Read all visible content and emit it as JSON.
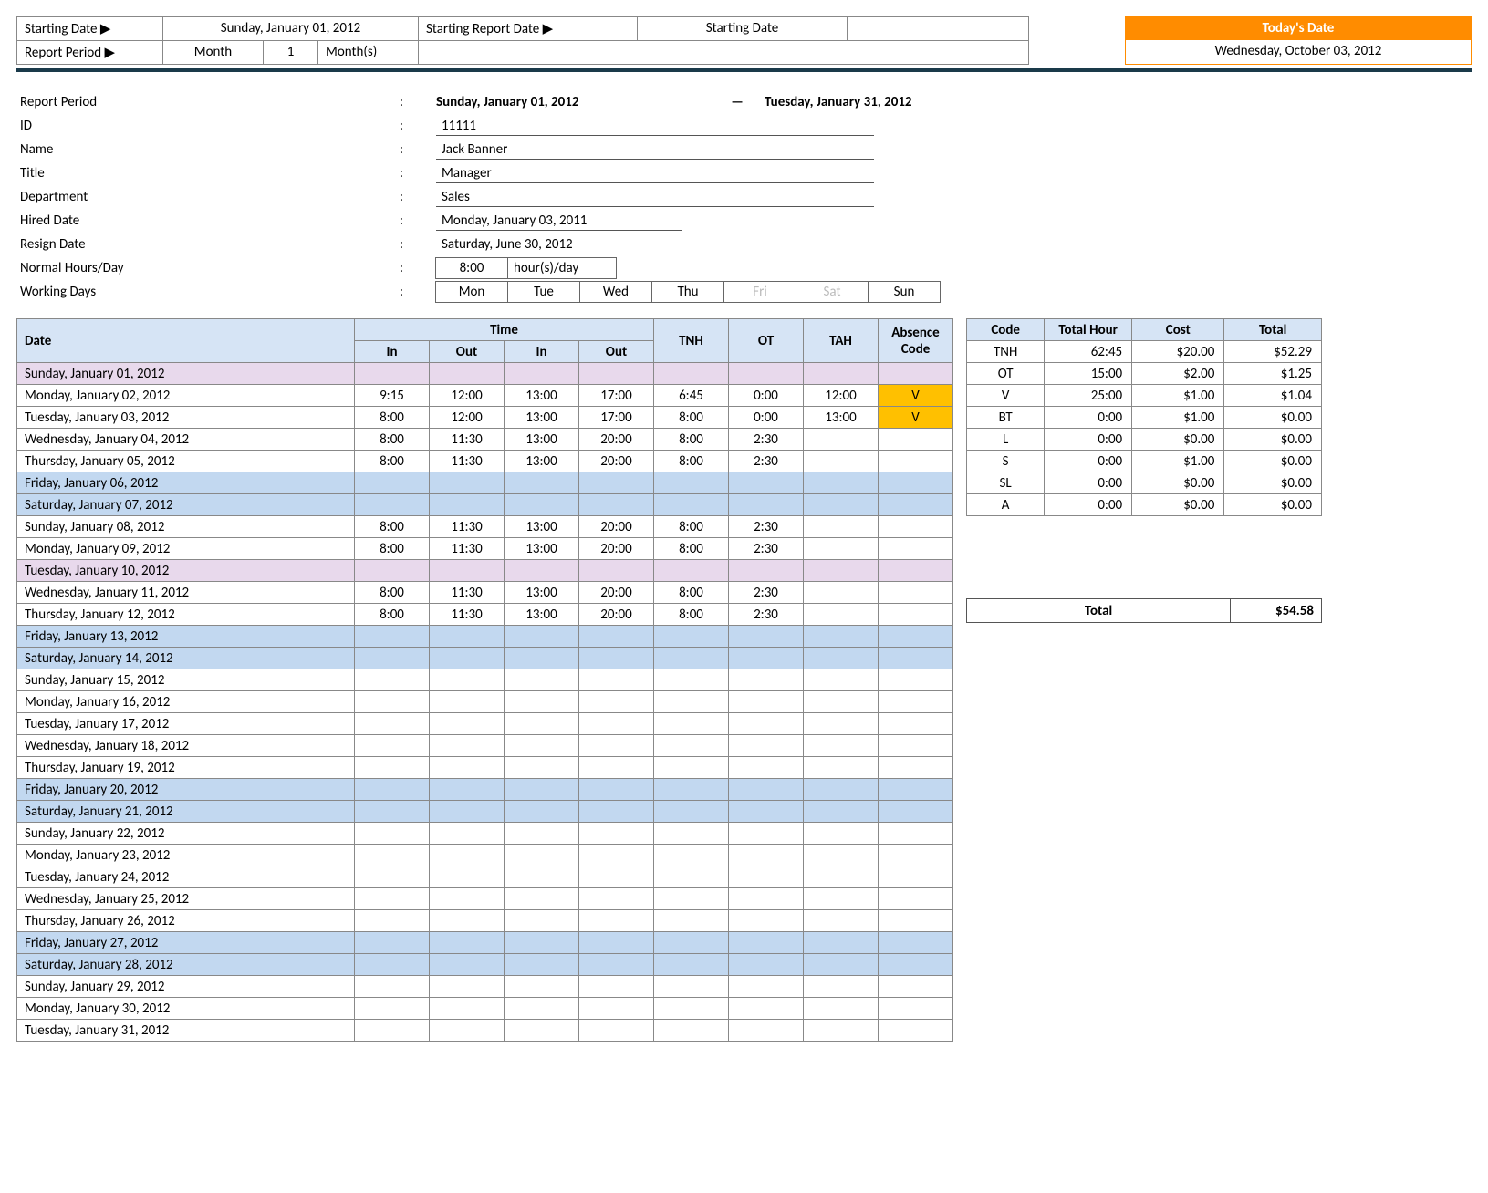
{
  "top": {
    "starting_date_lbl": "Starting Date ▶",
    "starting_date_val": "Sunday, January 01, 2012",
    "starting_report_lbl": "Starting Report Date ▶",
    "starting_report_val": "Starting Date",
    "report_period_lbl": "Report Period ▶",
    "report_period_type": "Month",
    "report_period_n": "1",
    "report_period_unit": "Month(s)",
    "today_hdr": "Today's Date",
    "today_val": "Wednesday, October 03, 2012"
  },
  "info": {
    "report_period_lbl": "Report Period",
    "report_period_from": "Sunday, January 01, 2012",
    "report_period_to": "Tuesday, January 31, 2012",
    "id_lbl": "ID",
    "id_val": "11111",
    "name_lbl": "Name",
    "name_val": "Jack Banner",
    "title_lbl": "Title",
    "title_val": "Manager",
    "dept_lbl": "Department",
    "dept_val": "Sales",
    "hired_lbl": "Hired Date",
    "hired_val": "Monday, January 03, 2011",
    "resign_lbl": "Resign Date",
    "resign_val": "Saturday, June 30, 2012",
    "normal_lbl": "Normal Hours/Day",
    "normal_hrs": "8:00",
    "normal_unit": "hour(s)/day",
    "working_lbl": "Working Days",
    "days": [
      "Mon",
      "Tue",
      "Wed",
      "Thu",
      "Fri",
      "Sat",
      "Sun"
    ],
    "days_off": [
      false,
      false,
      false,
      false,
      true,
      true,
      false
    ]
  },
  "ts_headers": {
    "date": "Date",
    "time": "Time",
    "in": "In",
    "out": "Out",
    "tnh": "TNH",
    "ot": "OT",
    "tah": "TAH",
    "abs": "Absence Code"
  },
  "ts_rows": [
    {
      "date": "Sunday, January 01, 2012",
      "cls": "purple"
    },
    {
      "date": "Monday, January 02, 2012",
      "in1": "9:15",
      "out1": "12:00",
      "in2": "13:00",
      "out2": "17:00",
      "tnh": "6:45",
      "ot": "0:00",
      "tah": "12:00",
      "abs": "V"
    },
    {
      "date": "Tuesday, January 03, 2012",
      "in1": "8:00",
      "out1": "12:00",
      "in2": "13:00",
      "out2": "17:00",
      "tnh": "8:00",
      "ot": "0:00",
      "tah": "13:00",
      "abs": "V"
    },
    {
      "date": "Wednesday, January 04, 2012",
      "in1": "8:00",
      "out1": "11:30",
      "in2": "13:00",
      "out2": "20:00",
      "tnh": "8:00",
      "ot": "2:30"
    },
    {
      "date": "Thursday, January 05, 2012",
      "in1": "8:00",
      "out1": "11:30",
      "in2": "13:00",
      "out2": "20:00",
      "tnh": "8:00",
      "ot": "2:30"
    },
    {
      "date": "Friday, January 06, 2012",
      "cls": "blue"
    },
    {
      "date": "Saturday, January 07, 2012",
      "cls": "blue"
    },
    {
      "date": "Sunday, January 08, 2012",
      "in1": "8:00",
      "out1": "11:30",
      "in2": "13:00",
      "out2": "20:00",
      "tnh": "8:00",
      "ot": "2:30"
    },
    {
      "date": "Monday, January 09, 2012",
      "in1": "8:00",
      "out1": "11:30",
      "in2": "13:00",
      "out2": "20:00",
      "tnh": "8:00",
      "ot": "2:30"
    },
    {
      "date": "Tuesday, January 10, 2012",
      "cls": "purple"
    },
    {
      "date": "Wednesday, January 11, 2012",
      "in1": "8:00",
      "out1": "11:30",
      "in2": "13:00",
      "out2": "20:00",
      "tnh": "8:00",
      "ot": "2:30"
    },
    {
      "date": "Thursday, January 12, 2012",
      "in1": "8:00",
      "out1": "11:30",
      "in2": "13:00",
      "out2": "20:00",
      "tnh": "8:00",
      "ot": "2:30"
    },
    {
      "date": "Friday, January 13, 2012",
      "cls": "blue"
    },
    {
      "date": "Saturday, January 14, 2012",
      "cls": "blue"
    },
    {
      "date": "Sunday, January 15, 2012"
    },
    {
      "date": "Monday, January 16, 2012"
    },
    {
      "date": "Tuesday, January 17, 2012"
    },
    {
      "date": "Wednesday, January 18, 2012"
    },
    {
      "date": "Thursday, January 19, 2012"
    },
    {
      "date": "Friday, January 20, 2012",
      "cls": "blue"
    },
    {
      "date": "Saturday, January 21, 2012",
      "cls": "blue"
    },
    {
      "date": "Sunday, January 22, 2012"
    },
    {
      "date": "Monday, January 23, 2012"
    },
    {
      "date": "Tuesday, January 24, 2012"
    },
    {
      "date": "Wednesday, January 25, 2012"
    },
    {
      "date": "Thursday, January 26, 2012"
    },
    {
      "date": "Friday, January 27, 2012",
      "cls": "blue"
    },
    {
      "date": "Saturday, January 28, 2012",
      "cls": "blue"
    },
    {
      "date": "Sunday, January 29, 2012"
    },
    {
      "date": "Monday, January 30, 2012"
    },
    {
      "date": "Tuesday, January 31, 2012"
    }
  ],
  "sum_headers": {
    "code": "Code",
    "hour": "Total Hour",
    "cost": "Cost",
    "total": "Total"
  },
  "sum_rows": [
    {
      "code": "TNH",
      "hour": "62:45",
      "cost": "$20.00",
      "total": "$52.29"
    },
    {
      "code": "OT",
      "hour": "15:00",
      "cost": "$2.00",
      "total": "$1.25"
    },
    {
      "code": "V",
      "hour": "25:00",
      "cost": "$1.00",
      "total": "$1.04"
    },
    {
      "code": "BT",
      "hour": "0:00",
      "cost": "$1.00",
      "total": "$0.00"
    },
    {
      "code": "L",
      "hour": "0:00",
      "cost": "$0.00",
      "total": "$0.00"
    },
    {
      "code": "S",
      "hour": "0:00",
      "cost": "$1.00",
      "total": "$0.00"
    },
    {
      "code": "SL",
      "hour": "0:00",
      "cost": "$0.00",
      "total": "$0.00"
    },
    {
      "code": "A",
      "hour": "0:00",
      "cost": "$0.00",
      "total": "$0.00"
    }
  ],
  "grand": {
    "lbl": "Total",
    "val": "$54.58"
  }
}
